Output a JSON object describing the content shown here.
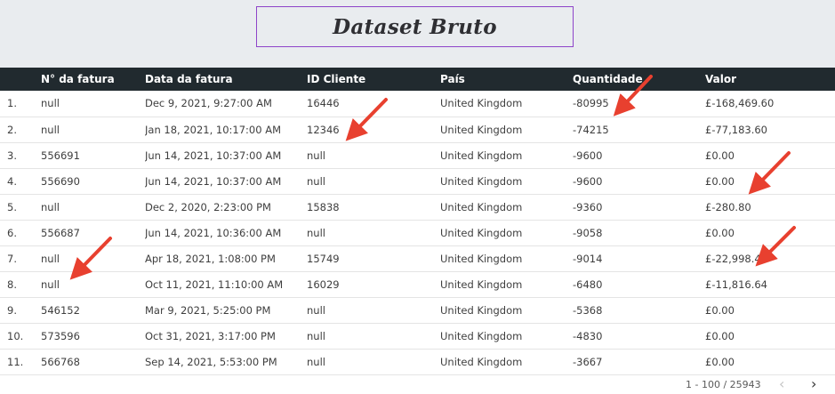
{
  "title": "Dataset Bruto",
  "table": {
    "columns": [
      "",
      "N° da fatura",
      "Data da fatura",
      "ID Cliente",
      "País",
      "Quantidade",
      "Valor"
    ],
    "rows": [
      [
        "1.",
        "null",
        "Dec 9, 2021, 9:27:00 AM",
        "16446",
        "United Kingdom",
        "-80995",
        "£-168,469.60"
      ],
      [
        "2.",
        "null",
        "Jan 18, 2021, 10:17:00 AM",
        "12346",
        "United Kingdom",
        "-74215",
        "£-77,183.60"
      ],
      [
        "3.",
        "556691",
        "Jun 14, 2021, 10:37:00 AM",
        "null",
        "United Kingdom",
        "-9600",
        "£0.00"
      ],
      [
        "4.",
        "556690",
        "Jun 14, 2021, 10:37:00 AM",
        "null",
        "United Kingdom",
        "-9600",
        "£0.00"
      ],
      [
        "5.",
        "null",
        "Dec 2, 2020, 2:23:00 PM",
        "15838",
        "United Kingdom",
        "-9360",
        "£-280.80"
      ],
      [
        "6.",
        "556687",
        "Jun 14, 2021, 10:36:00 AM",
        "null",
        "United Kingdom",
        "-9058",
        "£0.00"
      ],
      [
        "7.",
        "null",
        "Apr 18, 2021, 1:08:00 PM",
        "15749",
        "United Kingdom",
        "-9014",
        "£-22,998.40"
      ],
      [
        "8.",
        "null",
        "Oct 11, 2021, 11:10:00 AM",
        "16029",
        "United Kingdom",
        "-6480",
        "£-11,816.64"
      ],
      [
        "9.",
        "546152",
        "Mar 9, 2021, 5:25:00 PM",
        "null",
        "United Kingdom",
        "-5368",
        "£0.00"
      ],
      [
        "10.",
        "573596",
        "Oct 31, 2021, 3:17:00 PM",
        "null",
        "United Kingdom",
        "-4830",
        "£0.00"
      ],
      [
        "11.",
        "566768",
        "Sep 14, 2021, 5:53:00 PM",
        "null",
        "United Kingdom",
        "-3667",
        "£0.00"
      ]
    ]
  },
  "pagination": {
    "range": "1 - 100 / 25943",
    "prev_icon": "chevron-left-icon",
    "next_icon": "chevron-right-icon"
  },
  "colors": {
    "header_bg": "#212a2f",
    "title_border": "#8e44c9",
    "arrow": "#e8402f"
  }
}
